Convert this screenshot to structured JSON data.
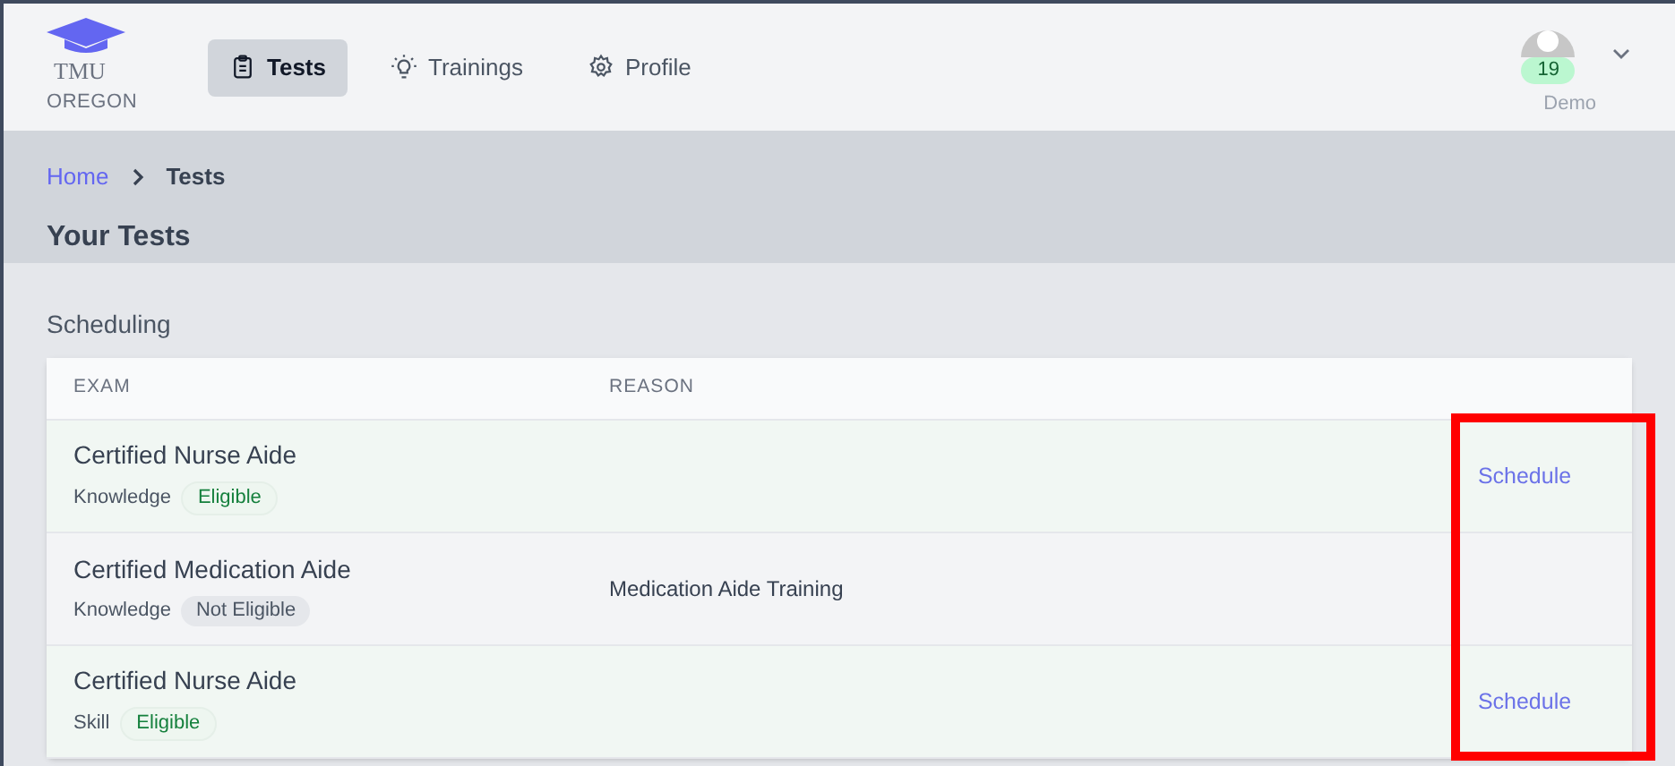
{
  "logo": {
    "name": "TMU",
    "region": "OREGON"
  },
  "nav": [
    {
      "label": "Tests",
      "kind": "clipboard",
      "selected": true
    },
    {
      "label": "Trainings",
      "kind": "bulb",
      "selected": false
    },
    {
      "label": "Profile",
      "kind": "gear",
      "selected": false
    }
  ],
  "user": {
    "badge": "19",
    "name": "Demo"
  },
  "breadcrumb": [
    "Home",
    "Tests"
  ],
  "page_title": "Your Tests",
  "section_title": "Scheduling",
  "table": {
    "columns": [
      "EXAM",
      "REASON"
    ],
    "rows": [
      {
        "exam": "Certified Nurse Aide",
        "type": "Knowledge",
        "status": "Eligible",
        "eligible": true,
        "action": "Schedule"
      },
      {
        "exam": "Certified Medication Aide",
        "type": "Knowledge",
        "status": "Not Eligible",
        "eligible": false,
        "reason": "Medication Aide Training"
      },
      {
        "exam": "Certified Nurse Aide",
        "type": "Skill",
        "status": "Eligible",
        "eligible": true,
        "action": "Schedule"
      }
    ]
  },
  "highlight": true
}
